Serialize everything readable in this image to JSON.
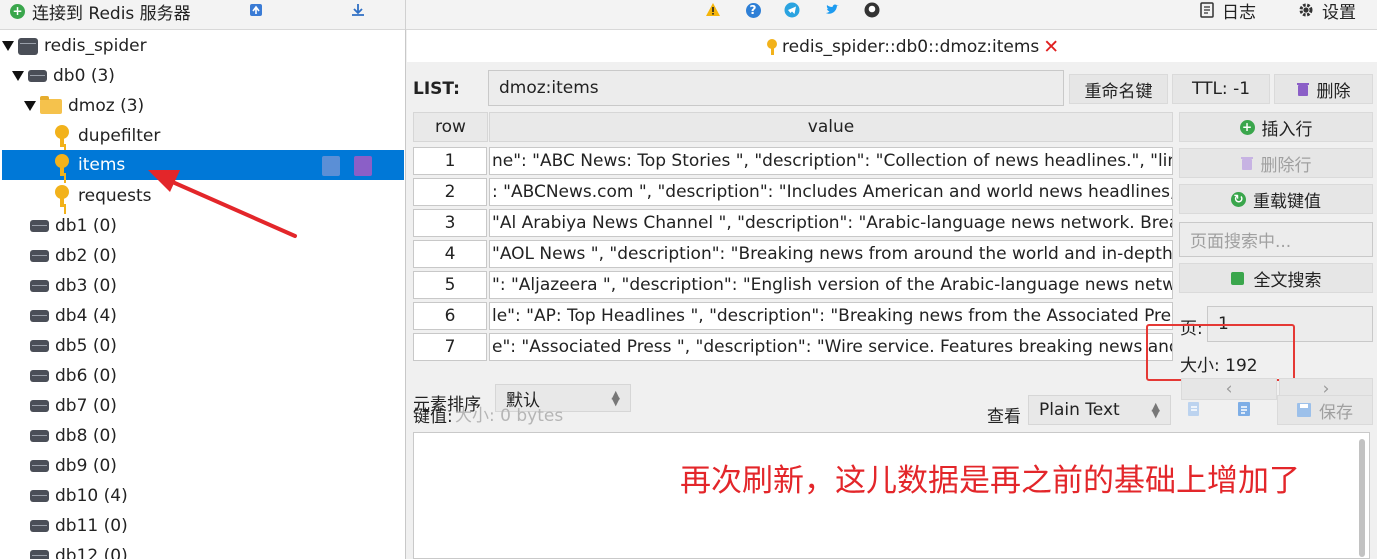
{
  "toolbar": {
    "connect_label": "连接到 Redis 服务器",
    "log_label": "日志",
    "settings_label": "设置"
  },
  "tree": {
    "server": "redis_spider",
    "db0": {
      "name": "db0",
      "count": "(3)"
    },
    "folder": {
      "name": "dmoz",
      "count": "(3)"
    },
    "keys": [
      "dupefilter",
      "items",
      "requests"
    ],
    "dbs": [
      {
        "name": "db1",
        "count": "(0)"
      },
      {
        "name": "db2",
        "count": "(0)"
      },
      {
        "name": "db3",
        "count": "(0)"
      },
      {
        "name": "db4",
        "count": "(4)"
      },
      {
        "name": "db5",
        "count": "(0)"
      },
      {
        "name": "db6",
        "count": "(0)"
      },
      {
        "name": "db7",
        "count": "(0)"
      },
      {
        "name": "db8",
        "count": "(0)"
      },
      {
        "name": "db9",
        "count": "(0)"
      },
      {
        "name": "db10",
        "count": "(4)"
      },
      {
        "name": "db11",
        "count": "(0)"
      },
      {
        "name": "db12",
        "count": "(0)"
      }
    ]
  },
  "tab": {
    "title": "redis_spider::db0::dmoz:items"
  },
  "key_view": {
    "type_label": "LIST:",
    "key_name": "dmoz:items",
    "rename_label": "重命名键",
    "ttl_label": "TTL:",
    "ttl_value": "-1",
    "delete_label": "删除"
  },
  "table": {
    "columns": [
      "row",
      "value"
    ],
    "rows": [
      {
        "n": "1",
        "v": "ne\": \"ABC News: Top Stories \", \"description\": \"Collection of news headlines.\", \"link\": \"http"
      },
      {
        "n": "2",
        "v": ": \"ABCNews.com \", \"description\": \"Includes American and world news headlines, articles"
      },
      {
        "n": "3",
        "v": "\"Al Arabiya News Channel \", \"description\": \"Arabic-language news network. Breaking ne"
      },
      {
        "n": "4",
        "v": "\"AOL News \", \"description\": \"Breaking news from around the world and in-depth covera"
      },
      {
        "n": "5",
        "v": "\": \"Aljazeera \", \"description\": \"English version of the Arabic-language news network. Bre"
      },
      {
        "n": "6",
        "v": "le\": \"AP: Top Headlines \", \"description\": \"Breaking news from the Associated Press.\", \"link"
      },
      {
        "n": "7",
        "v": "e\": \"Associated Press \", \"description\": \"Wire service. Features breaking news and special"
      }
    ]
  },
  "side": {
    "insert_row": "插入行",
    "delete_row": "删除行",
    "reload": "重载键值",
    "search_placeholder": "页面搜索中...",
    "fulltext": "全文搜索",
    "page_label": "页:",
    "page_value": "1",
    "size_label": "大小:",
    "size_value": "192"
  },
  "value_bar": {
    "sort_label": "元素排序",
    "sort_value": "默认",
    "key_label": "键值:",
    "size_text": "大小: 0 bytes",
    "view_label": "查看",
    "view_mode": "Plain Text",
    "save_label": "保存"
  },
  "annotation": "再次刷新，这儿数据是再之前的基础上增加了",
  "colors": {
    "selection": "#0078d7",
    "annotation": "#e3262a",
    "key_icon": "#f2b21b"
  }
}
